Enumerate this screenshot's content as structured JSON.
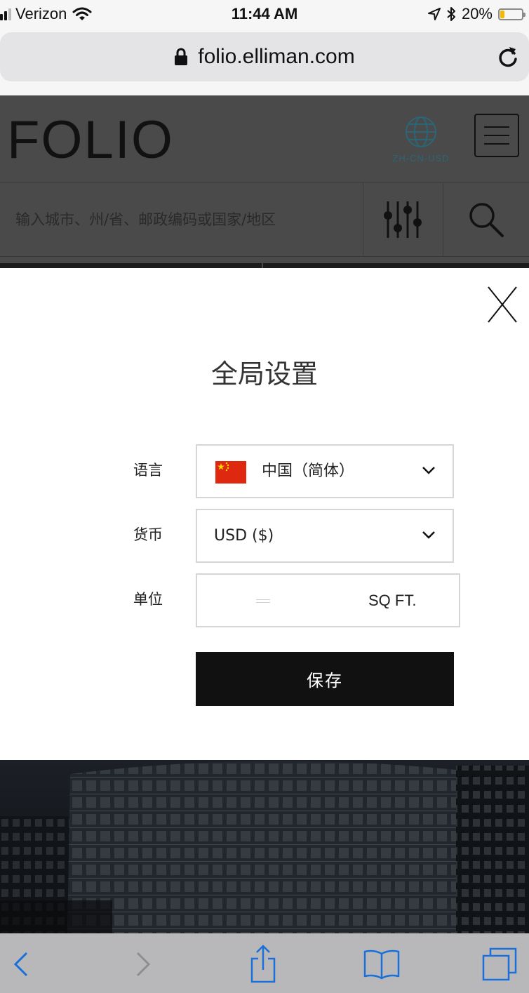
{
  "status_bar": {
    "carrier": "Verizon",
    "time": "11:44 AM",
    "battery_percent": "20%",
    "battery_level": 0.2
  },
  "browser": {
    "url": "folio.elliman.com"
  },
  "site_header": {
    "logo": "FOLIO",
    "locale_code": "ZH-CN-USD",
    "search_placeholder": "输入城市、州/省、邮政编码或国家/地区"
  },
  "modal": {
    "title": "全局设置",
    "language_label": "语言",
    "language_value": "中国（简体）",
    "currency_label": "货币",
    "currency_value": "USD ($)",
    "unit_label": "单位",
    "unit_value": "SQ FT.",
    "save_label": "保存"
  },
  "colors": {
    "accent_locale": "#2b6676",
    "save_button": "#111111",
    "flag_red": "#de2910",
    "flag_yellow": "#ffde00",
    "battery_fill": "#f5b700"
  }
}
